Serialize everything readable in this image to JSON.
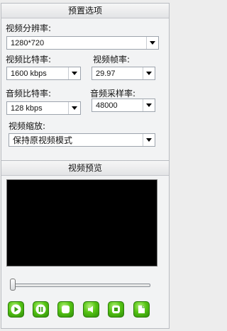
{
  "preset": {
    "title": "预置选项",
    "resolution": {
      "label": "视频分辨率:",
      "value": "1280*720"
    },
    "video_bitrate": {
      "label": "视频比特率:",
      "value": "1600 kbps"
    },
    "frame_rate": {
      "label": "视频帧率:",
      "value": "29.97"
    },
    "audio_bitrate": {
      "label": "音频比特率:",
      "value": "128 kbps"
    },
    "sample_rate": {
      "label": "音频采样率:",
      "value": "48000"
    },
    "scaling": {
      "label": "视频缩放:",
      "value": "保持原视频模式"
    }
  },
  "preview": {
    "title": "视频预览",
    "buttons": [
      {
        "icon": "play-icon"
      },
      {
        "icon": "pause-icon"
      },
      {
        "icon": "stop-icon"
      },
      {
        "icon": "volume-icon"
      },
      {
        "icon": "fullscreen-icon"
      },
      {
        "icon": "snapshot-icon"
      }
    ]
  }
}
